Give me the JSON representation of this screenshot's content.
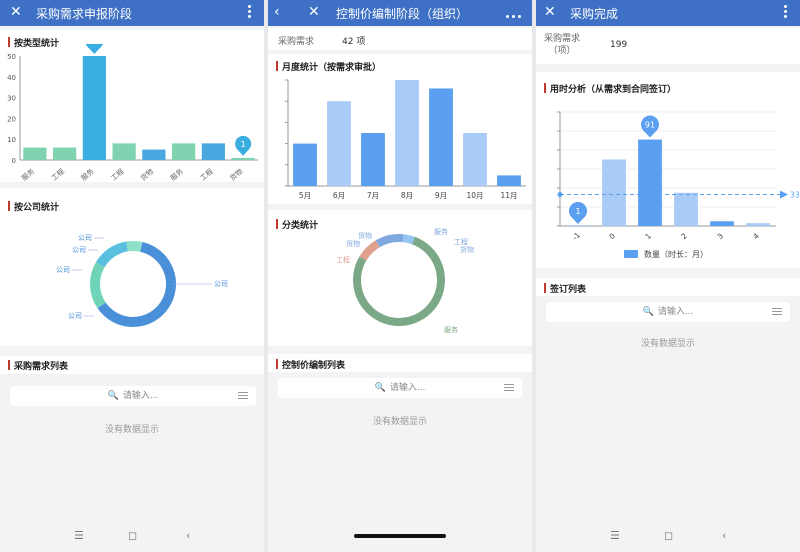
{
  "panel1": {
    "title": "采购需求申报阶段",
    "sec_type": "按类型统计",
    "sec_company": "按公司统计",
    "sec_list": "采购需求列表",
    "search_placeholder": "请输入...",
    "empty_text": "没有数据显示",
    "bubble_max": "50",
    "bubble_last": "1",
    "pie_labels": [
      "公司",
      "公司",
      "公司",
      "公司"
    ],
    "pie_right_label": "公司"
  },
  "panel2": {
    "title": "控制价编制阶段（组织）",
    "demand_label": "采购需求",
    "demand_value": "42 项",
    "sec_monthly": "月度统计（按需求审批）",
    "sec_category": "分类统计",
    "sec_list": "控制价编制列表",
    "search_placeholder": "请输入...",
    "empty_text": "没有数据显示",
    "donut_labels": {
      "goods1": "货物",
      "goods2": "货物",
      "service1": "服务",
      "engineering1": "工程",
      "engineering2": "工程",
      "goods3": "货物",
      "service2": "服务"
    }
  },
  "panel3": {
    "title": "采购完成",
    "demand_label": "采购需求\n（项）",
    "demand_value": "199",
    "sec_time": "用时分析（从需求到合同签订）",
    "sec_list": "签订列表",
    "search_placeholder": "请输入...",
    "empty_text": "没有数据显示",
    "bubble_max": "91",
    "bubble_min": "1",
    "avg_label": "33.1",
    "legend": "数量（时长：月）"
  },
  "chart_data": [
    {
      "type": "bar",
      "title": "按类型统计",
      "categories": [
        "服务",
        "工程",
        "服务",
        "工程",
        "货物",
        "服务",
        "工程",
        "货物"
      ],
      "values": [
        6,
        6,
        50,
        8,
        5,
        8,
        8,
        1
      ],
      "ylim": [
        0,
        50
      ],
      "yticks": [
        0,
        10,
        20,
        30,
        40,
        50
      ],
      "grid": false
    },
    {
      "type": "pie",
      "title": "按公司统计",
      "donut": true,
      "slices": [
        {
          "label": "公司",
          "value": 62,
          "color": "#4a90d9"
        },
        {
          "label": "公司",
          "value": 18,
          "color": "#6fd3b8"
        },
        {
          "label": "公司",
          "value": 14,
          "color": "#5bbfe0"
        },
        {
          "label": "公司",
          "value": 6,
          "color": "#8ee0c8"
        }
      ]
    },
    {
      "type": "bar",
      "title": "月度统计（按需求审批）",
      "categories": [
        "5月",
        "6月",
        "7月",
        "8月",
        "9月",
        "10月",
        "11月"
      ],
      "values": [
        10,
        20,
        12.5,
        25,
        23,
        12.5,
        2.5
      ],
      "ylim": [
        0,
        25
      ],
      "colors": [
        "#5b9ff0",
        "#a9cbf7",
        "#5b9ff0",
        "#a9cbf7",
        "#5b9ff0",
        "#a9cbf7",
        "#5b9ff0"
      ],
      "grid": false
    },
    {
      "type": "pie",
      "title": "分类统计",
      "donut": true,
      "slices": [
        {
          "label": "服务",
          "value": 78,
          "color": "#7ba887"
        },
        {
          "label": "工程",
          "value": 8,
          "color": "#e0a08e"
        },
        {
          "label": "货物",
          "value": 10,
          "color": "#7fa7e0"
        },
        {
          "label": "服务",
          "value": 4,
          "color": "#96c6ef"
        }
      ]
    },
    {
      "type": "bar",
      "title": "用时分析（从需求到合同签订）",
      "categories": [
        "-1",
        "0",
        "1",
        "2",
        "3",
        "4"
      ],
      "values": [
        1,
        70,
        91,
        35,
        5,
        3
      ],
      "ylim": [
        0,
        120
      ],
      "average": 33.1,
      "series": [
        {
          "name": "数量（时长：月）",
          "values": [
            1,
            70,
            91,
            35,
            5,
            3
          ]
        }
      ],
      "colors": [
        "#a9cbf7",
        "#a9cbf7",
        "#5b9ff0",
        "#a9cbf7",
        "#5b9ff0",
        "#a9cbf7"
      ],
      "grid": true
    }
  ]
}
